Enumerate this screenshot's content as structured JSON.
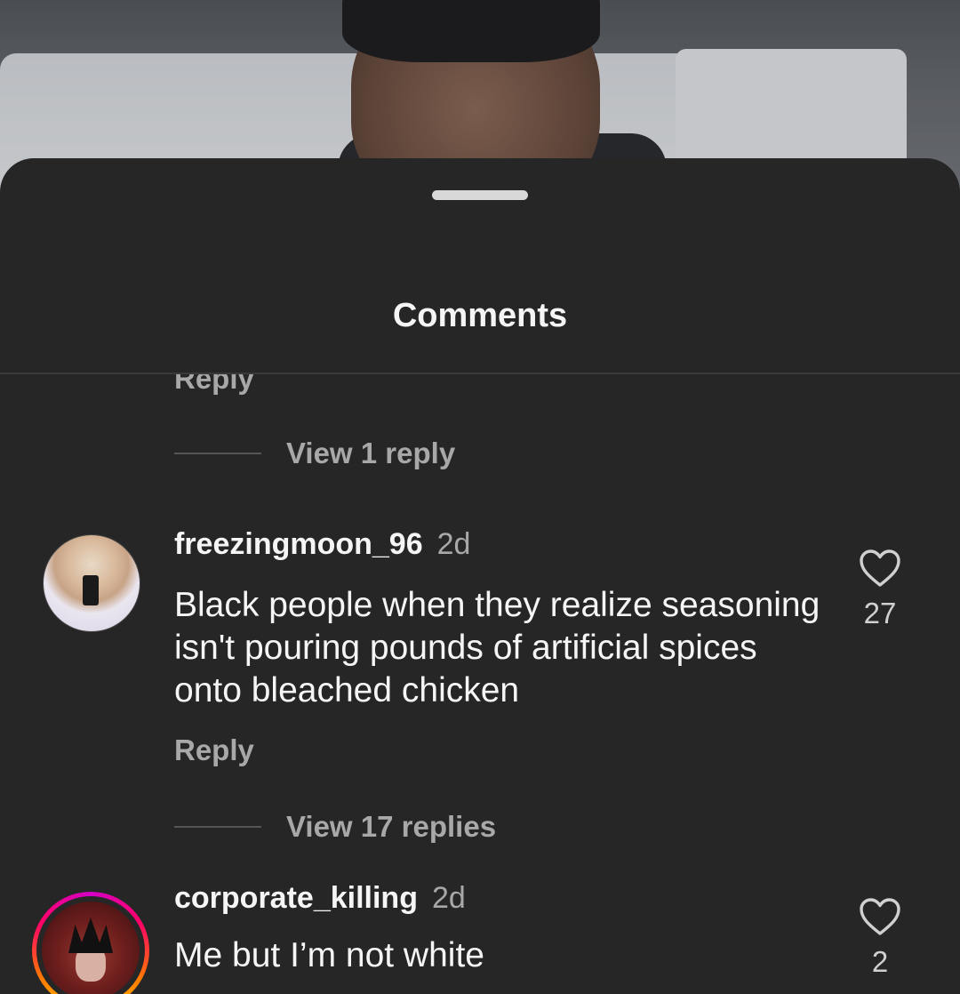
{
  "sheet": {
    "title": "Comments"
  },
  "top_partial": {
    "reply_label": "Reply",
    "view_replies_label": "View 1 reply"
  },
  "comments": [
    {
      "username": "freezingmoon_96",
      "time": "2d",
      "text": "Black people when they realize seasoning isn't pouring pounds of artificial spices onto bleached chicken",
      "likes": "27",
      "reply_label": "Reply",
      "view_replies_label": "View 17 replies",
      "avatar_icon": "profile-photo-avatar"
    },
    {
      "username": "corporate_killing",
      "time": "2d",
      "text": "Me but I’m not white",
      "likes": "2",
      "avatar_icon": "story-ring-avatar"
    }
  ],
  "icons": {
    "like": "heart-outline-icon"
  },
  "colors": {
    "sheet_background": "#262626",
    "primary_text": "#f5f5f5",
    "secondary_text": "#a8a8a8"
  }
}
